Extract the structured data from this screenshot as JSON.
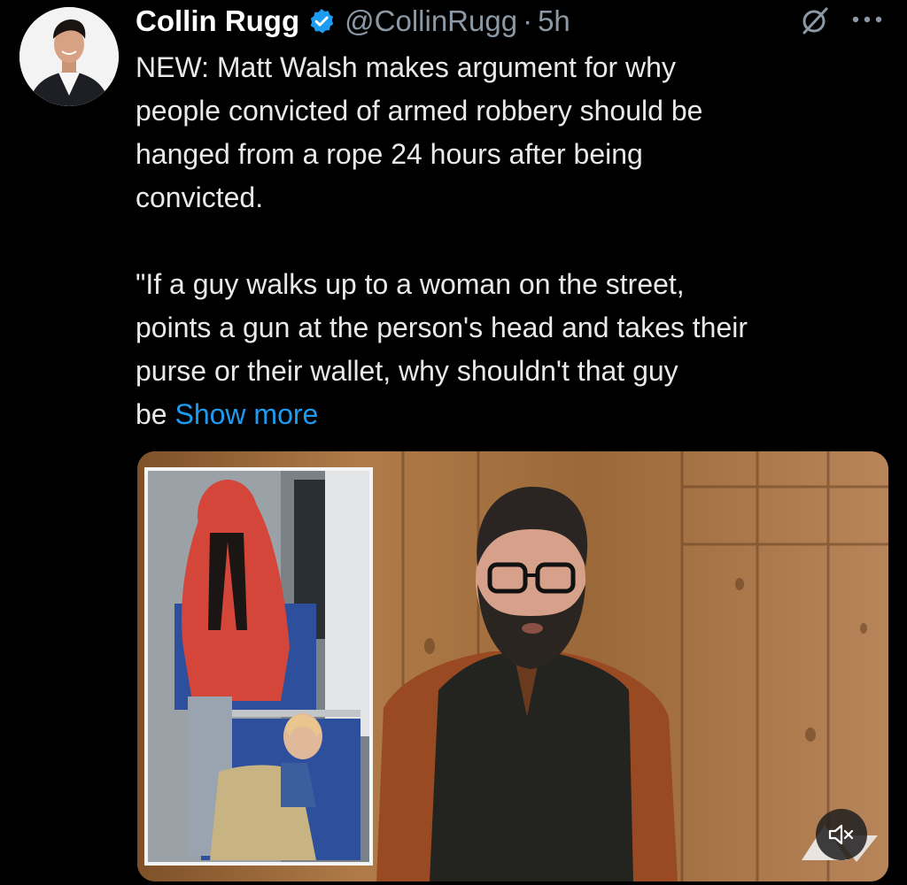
{
  "tweet": {
    "author_name": "Collin Rugg",
    "handle": "@CollinRugg",
    "separator": "·",
    "time": "5h",
    "text_paragraph_1": "NEW: Matt Walsh makes argument for why\npeople convicted of armed robbery should be\nhanged from a rope 24 hours after being\nconvicted.",
    "text_paragraph_2": "\"If a guy walks up to a woman on the street,\npoints a gun at the person's head and takes their\npurse or their wallet, why shouldn't that guy\nbe ",
    "show_more": "Show more"
  },
  "icons": {
    "verified": "verified-badge-icon",
    "grok": "grok-icon",
    "more": "more-options-icon",
    "mute": "volume-muted-icon"
  },
  "colors": {
    "background": "#000000",
    "text": "#e7e9ea",
    "secondary": "#8b98a5",
    "link": "#1d9bf0",
    "verified": "#1d9bf0"
  }
}
